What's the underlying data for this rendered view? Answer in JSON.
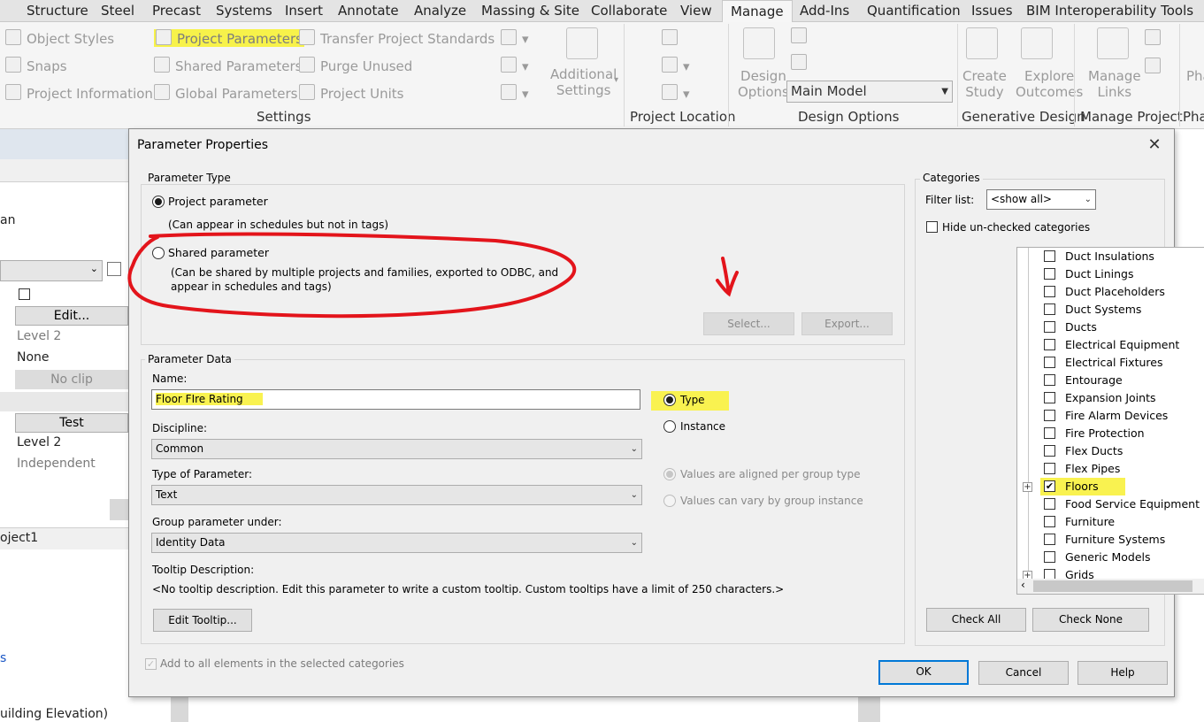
{
  "ribbon": {
    "tabs": [
      "Structure",
      "Steel",
      "Precast",
      "Systems",
      "Insert",
      "Annotate",
      "Analyze",
      "Massing & Site",
      "Collaborate",
      "View",
      "Manage",
      "Add-Ins",
      "Quantification",
      "Issues",
      "BIM Interoperability Tools"
    ],
    "settings": {
      "object_styles": "Object  Styles",
      "snaps": "Snaps",
      "project_information": "Project  Information",
      "project_parameters": "Project  Parameters",
      "shared_parameters": "Shared  Parameters",
      "global_parameters": "Global  Parameters",
      "transfer_project_standards": "Transfer  Project Standards",
      "purge_unused": "Purge  Unused",
      "project_units": "Project  Units",
      "additional_settings_1": "Additional",
      "additional_settings_2": "Settings",
      "title": "Settings"
    },
    "project_location": {
      "title": "Project Location"
    },
    "design_options": {
      "design_1": "Design",
      "design_2": "Options",
      "main_model": "Main Model",
      "title": "Design Options"
    },
    "generative_design": {
      "create_1": "Create",
      "create_2": "Study",
      "explore_1": "Explore",
      "explore_2": "Outcomes",
      "title": "Generative Design"
    },
    "manage_project": {
      "manage_1": "Manage",
      "manage_2": "Links",
      "title": "Manage Project"
    },
    "cut_1": "Pha",
    "cut_2": "Pha"
  },
  "left_panel": {
    "an": "an",
    "edit": "Edit...",
    "level2_a": "Level 2",
    "none": "None",
    "no_clip": "No clip",
    "test": "Test",
    "level2_b": "Level 2",
    "independent": "Independent",
    "project1": "oject1",
    "building_elevation": "uilding Elevation)"
  },
  "dialog": {
    "title": "Parameter Properties",
    "close": "✕",
    "parameter_type": {
      "label": "Parameter Type",
      "project_parameter": "Project parameter",
      "project_desc": "(Can appear in schedules but not in tags)",
      "shared_parameter": "Shared parameter",
      "shared_desc_1": "(Can be shared by multiple projects and families, exported to ODBC, and",
      "shared_desc_2": "appear in schedules and tags)",
      "select": "Select...",
      "export": "Export..."
    },
    "parameter_data": {
      "label": "Parameter Data",
      "name_label": "Name:",
      "name_value": "Floor FIre Rating",
      "type": "Type",
      "instance": "Instance",
      "discipline_label": "Discipline:",
      "discipline_value": "Common",
      "type_of_parameter_label": "Type of Parameter:",
      "type_of_parameter_value": "Text",
      "values_aligned": "Values are aligned per group type",
      "values_vary": "Values can vary by group instance",
      "group_under_label": "Group parameter under:",
      "group_under_value": "Identity Data",
      "tooltip_label": "Tooltip Description:",
      "tooltip_text": "<No tooltip description. Edit this parameter to write a custom tooltip. Custom tooltips have a limit of 250 characters.>",
      "edit_tooltip": "Edit Tooltip...",
      "add_to_all": "Add to all elements in the selected categories"
    },
    "categories": {
      "label": "Categories",
      "filter_label": "Filter list:",
      "filter_value": "<show all>",
      "hide_unchecked": "Hide un-checked categories",
      "items": [
        "Duct Insulations",
        "Duct Linings",
        "Duct Placeholders",
        "Duct Systems",
        "Ducts",
        "Electrical Equipment",
        "Electrical Fixtures",
        "Entourage",
        "Expansion Joints",
        "Fire Alarm Devices",
        "Fire Protection",
        "Flex Ducts",
        "Flex Pipes",
        "Floors",
        "Food Service Equipment",
        "Furniture",
        "Furniture Systems",
        "Generic Models",
        "Grids"
      ],
      "checked_item": "Floors",
      "check_all": "Check All",
      "check_none": "Check None"
    },
    "ok": "OK",
    "cancel": "Cancel",
    "help": "Help"
  },
  "colors": {
    "annotation_red": "#e3141b",
    "highlight_yellow": "#f7f24a",
    "accent_blue": "#0078d7"
  }
}
